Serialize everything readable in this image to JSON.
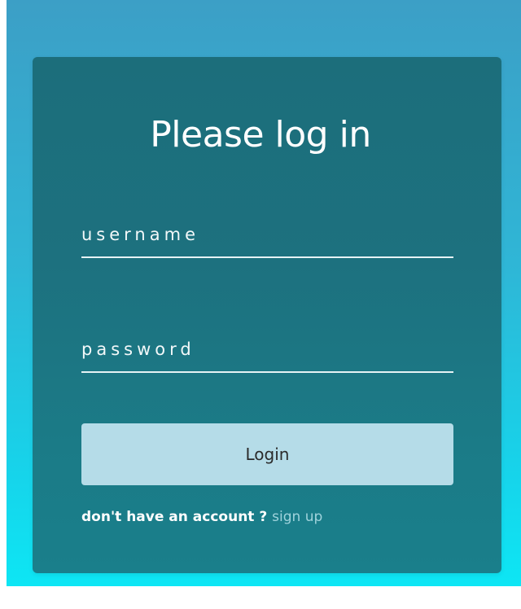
{
  "login_form": {
    "title": "Please log in",
    "username": {
      "placeholder": "username",
      "value": ""
    },
    "password": {
      "placeholder": "password",
      "value": ""
    },
    "login_button_label": "Login",
    "signup_prompt": "don't have an account ?",
    "signup_link_label": "sign up"
  },
  "colors": {
    "background_top": "#3c9fc6",
    "background_bottom": "#0de6f4",
    "card": "#1c6e7b",
    "button": "#b5dce8",
    "link": "#9fd3dc"
  }
}
